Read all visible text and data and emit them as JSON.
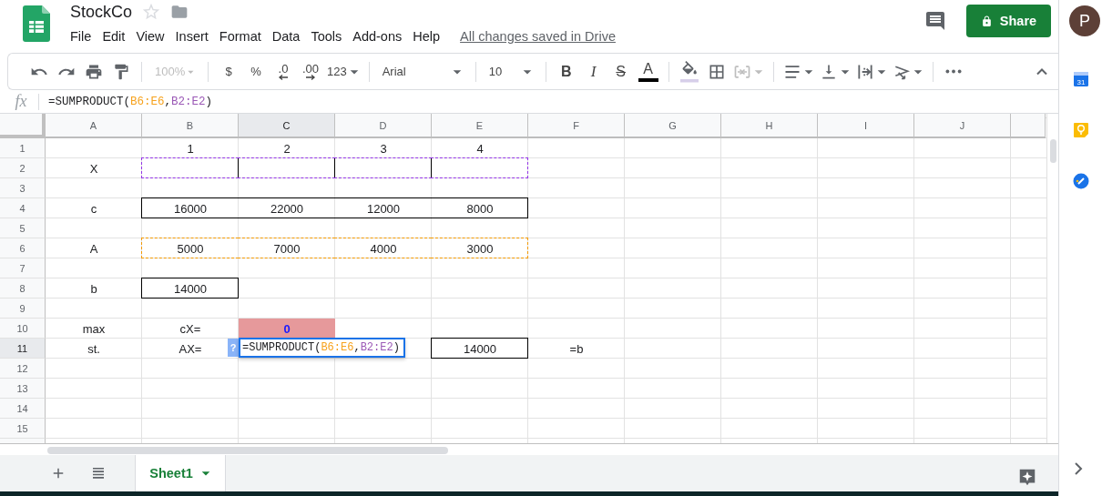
{
  "app": {
    "title": "StockCo",
    "menu": [
      "File",
      "Edit",
      "View",
      "Insert",
      "Format",
      "Data",
      "Tools",
      "Add-ons",
      "Help"
    ],
    "save_status": "All changes saved in Drive",
    "share": "Share",
    "avatar": "P"
  },
  "toolbar": {
    "zoom": {
      "value": "100%",
      "disabled": true
    },
    "currency": "$",
    "percent": "%",
    "decrease_decimals": ".0",
    "increase_decimals": ".00",
    "number_formats": "123",
    "font": "Arial",
    "font_size": "10",
    "bold": "B",
    "italic": "I",
    "strikethrough": "S",
    "text_color": "A"
  },
  "formula_bar": {
    "label": "fx",
    "formula": [
      {
        "text": "=SUMPRODUCT("
      },
      {
        "text": "B6:E6",
        "color": "#f6a21e"
      },
      {
        "text": ","
      },
      {
        "text": "B2:E2",
        "color": "#9b59b6"
      },
      {
        "text": ")"
      }
    ]
  },
  "sheet": {
    "columns": [
      {
        "label": "A",
        "selected": false
      },
      {
        "label": "B",
        "selected": false
      },
      {
        "label": "C",
        "selected": true
      },
      {
        "label": "D",
        "selected": false
      },
      {
        "label": "E",
        "selected": false
      },
      {
        "label": "F",
        "selected": false
      },
      {
        "label": "G",
        "selected": false
      },
      {
        "label": "H",
        "selected": false
      },
      {
        "label": "I",
        "selected": false
      },
      {
        "label": "J",
        "selected": false
      }
    ],
    "rows": [
      {
        "number": "1",
        "selected": false,
        "cells": [
          null,
          "1",
          "2",
          "3",
          "4",
          null,
          null,
          null,
          null,
          null
        ]
      },
      {
        "number": "2",
        "selected": false,
        "cells": [
          "X",
          {
            "kind": "boxed",
            "highlighted": true,
            "color": "#9334e6"
          },
          {
            "kind": "boxed",
            "highlighted": true,
            "color": "#9334e6"
          },
          {
            "kind": "boxed",
            "highlighted": true,
            "color": "#9334e6"
          },
          {
            "kind": "boxed",
            "highlighted": true,
            "color": "#9334e6"
          },
          null,
          null,
          null,
          null,
          null
        ]
      },
      {
        "number": "3",
        "selected": false,
        "cells": [
          null,
          null,
          null,
          null,
          null,
          null,
          null,
          null,
          null,
          null
        ]
      },
      {
        "number": "4",
        "selected": false,
        "cells": [
          "c",
          {
            "text": "16000",
            "kind": "outlined"
          },
          {
            "text": "22000",
            "kind": "outlined"
          },
          {
            "text": "12000",
            "kind": "outlined"
          },
          {
            "text": "8000",
            "kind": "outlined"
          },
          null,
          null,
          null,
          null,
          null
        ]
      },
      {
        "number": "5",
        "selected": false,
        "cells": [
          null,
          null,
          null,
          null,
          null,
          null,
          null,
          null,
          null,
          null
        ]
      },
      {
        "number": "6",
        "selected": false,
        "cells": [
          "A",
          {
            "text": "5000",
            "highlighted": true,
            "color": "#f29900"
          },
          {
            "text": "7000",
            "highlighted": true,
            "color": "#f29900"
          },
          {
            "text": "4000",
            "highlighted": true,
            "color": "#f29900"
          },
          {
            "text": "3000",
            "highlighted": true,
            "color": "#f29900"
          },
          null,
          null,
          null,
          null,
          null
        ]
      },
      {
        "number": "7",
        "selected": false,
        "cells": [
          null,
          null,
          null,
          null,
          null,
          null,
          null,
          null,
          null,
          null
        ]
      },
      {
        "number": "8",
        "selected": false,
        "cells": [
          "b",
          {
            "text": "14000",
            "kind": "outlined"
          },
          null,
          null,
          null,
          null,
          null,
          null,
          null,
          null
        ]
      },
      {
        "number": "9",
        "selected": false,
        "cells": [
          null,
          null,
          null,
          null,
          null,
          null,
          null,
          null,
          null,
          null
        ]
      },
      {
        "number": "10",
        "selected": false,
        "cells": [
          "max",
          "cX=",
          {
            "text": "0",
            "kind": "result",
            "color": "#e6999b"
          },
          null,
          null,
          null,
          null,
          null,
          null,
          null
        ]
      },
      {
        "number": "11",
        "selected": true,
        "cells": [
          "st.",
          "AX=",
          {
            "kind": "editor",
            "help": "?",
            "formula": [
              {
                "text": "=SUMPRODUCT("
              },
              {
                "text": "B6:E6",
                "color": "#f6a21e"
              },
              {
                "text": ","
              },
              {
                "text": "B2:E2",
                "color": "#9b59b6"
              },
              {
                "text": ")"
              }
            ]
          },
          null,
          {
            "text": "14000",
            "kind": "outlined"
          },
          "=b",
          null,
          null,
          null,
          null
        ]
      },
      {
        "number": "12",
        "selected": false,
        "cells": [
          null,
          null,
          null,
          null,
          null,
          null,
          null,
          null,
          null,
          null
        ]
      },
      {
        "number": "13",
        "selected": false,
        "cells": [
          null,
          null,
          null,
          null,
          null,
          null,
          null,
          null,
          null,
          null
        ]
      },
      {
        "number": "14",
        "selected": false,
        "cells": [
          null,
          null,
          null,
          null,
          null,
          null,
          null,
          null,
          null,
          null
        ]
      },
      {
        "number": "15",
        "selected": false,
        "cells": [
          null,
          null,
          null,
          null,
          null,
          null,
          null,
          null,
          null,
          null
        ]
      }
    ]
  },
  "sheet_tabs": [
    {
      "label": "Sheet1",
      "selected": true
    }
  ],
  "side_panel": {
    "calendar_day": "31"
  }
}
